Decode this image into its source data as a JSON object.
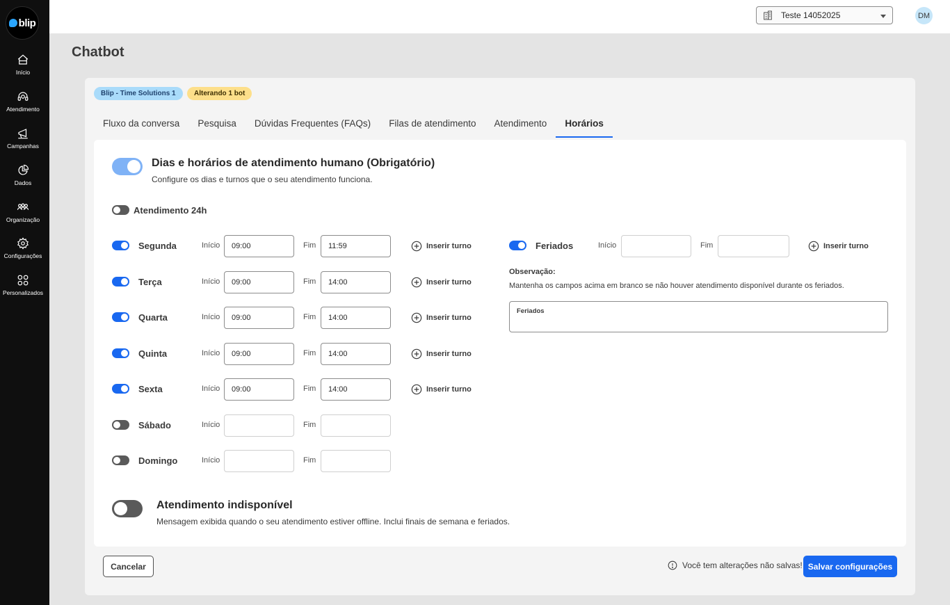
{
  "sidebar": {
    "logo_text": "blip",
    "items": [
      {
        "label": "Início",
        "icon": "home-icon"
      },
      {
        "label": "Atendimento",
        "icon": "headset-icon"
      },
      {
        "label": "Campanhas",
        "icon": "megaphone-icon"
      },
      {
        "label": "Dados",
        "icon": "pie-chart-icon"
      },
      {
        "label": "Organização",
        "icon": "users-icon"
      },
      {
        "label": "Configurações",
        "icon": "gear-icon"
      },
      {
        "label": "Personalizados",
        "icon": "grid-icon"
      }
    ]
  },
  "topbar": {
    "tenant": "Teste 14052025",
    "avatar_initials": "DM"
  },
  "page": {
    "title": "Chatbot",
    "badges": [
      "Blip - Time Solutions 1",
      "Alterando 1 bot"
    ],
    "tabs": [
      "Fluxo da conversa",
      "Pesquisa",
      "Dúvidas Frequentes (FAQs)",
      "Filas de atendimento",
      "Atendimento",
      "Horários"
    ],
    "active_tab": "Horários"
  },
  "schedule": {
    "title": "Dias e horários de atendimento humano (Obrigatório)",
    "subtitle": "Configure os dias e turnos que o seu atendimento funciona.",
    "always_on_label": "Atendimento 24h",
    "start_label": "Início",
    "end_label": "Fim",
    "insert_label": "Inserir turno",
    "days": [
      {
        "name": "Segunda",
        "enabled": true,
        "start": "09:00",
        "end": "11:59"
      },
      {
        "name": "Terça",
        "enabled": true,
        "start": "09:00",
        "end": "14:00"
      },
      {
        "name": "Quarta",
        "enabled": true,
        "start": "09:00",
        "end": "14:00"
      },
      {
        "name": "Quinta",
        "enabled": true,
        "start": "09:00",
        "end": "14:00"
      },
      {
        "name": "Sexta",
        "enabled": true,
        "start": "09:00",
        "end": "14:00"
      },
      {
        "name": "Sábado",
        "enabled": false,
        "start": "",
        "end": ""
      },
      {
        "name": "Domingo",
        "enabled": false,
        "start": "",
        "end": ""
      }
    ],
    "holidays": {
      "name": "Feriados",
      "enabled": true,
      "start": "",
      "end": "",
      "obs_title": "Observação:",
      "obs_text": "Mantenha os campos acima em branco se não houver atendimento disponível durante os feriados.",
      "box_label": "Feriados"
    }
  },
  "unavailable": {
    "title": "Atendimento indisponível",
    "subtitle": "Mensagem exibida quando o seu atendimento estiver offline. Inclui finais de semana e feriados."
  },
  "footer": {
    "cancel": "Cancelar",
    "unsaved": "Você tem alterações não salvas!",
    "save": "Salvar configurações"
  },
  "colors": {
    "primary": "#1968f0",
    "sidebar_bg": "#0f0f0f",
    "badge_blue": "#a9dbfa",
    "badge_yellow": "#fddf8a"
  }
}
